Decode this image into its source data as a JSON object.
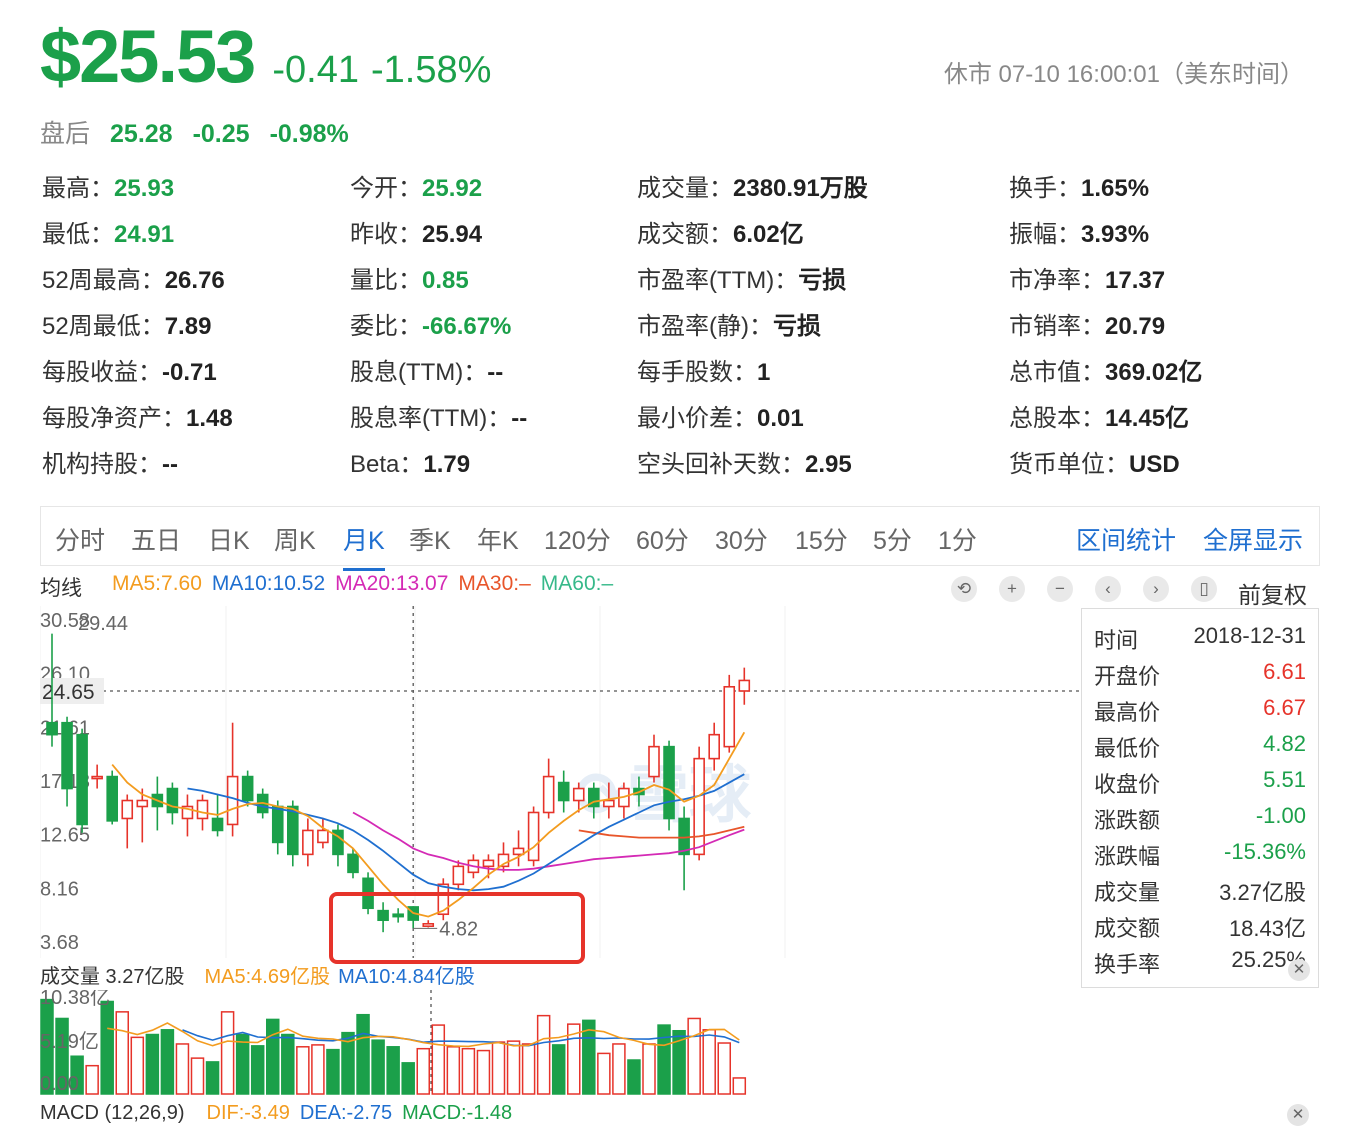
{
  "header": {
    "price": "$25.53",
    "change": "-0.41",
    "change_pct": "-1.58%",
    "status": "休市 07-10 16:00:01（美东时间）"
  },
  "after_hours": {
    "label": "盘后",
    "price": "25.28",
    "change": "-0.25",
    "change_pct": "-0.98%"
  },
  "stats": [
    [
      {
        "k": "最高：",
        "v": "25.93",
        "g": true
      },
      {
        "k": "今开：",
        "v": "25.92",
        "g": true
      },
      {
        "k": "成交量：",
        "v": "2380.91万股"
      },
      {
        "k": "换手：",
        "v": "1.65%"
      }
    ],
    [
      {
        "k": "最低：",
        "v": "24.91",
        "g": true
      },
      {
        "k": "昨收：",
        "v": "25.94"
      },
      {
        "k": "成交额：",
        "v": "6.02亿"
      },
      {
        "k": "振幅：",
        "v": "3.93%"
      }
    ],
    [
      {
        "k": "52周最高：",
        "v": "26.76"
      },
      {
        "k": "量比：",
        "v": "0.85",
        "g": true
      },
      {
        "k": "市盈率(TTM)：",
        "v": "亏损"
      },
      {
        "k": "市净率：",
        "v": "17.37"
      }
    ],
    [
      {
        "k": "52周最低：",
        "v": "7.89"
      },
      {
        "k": "委比：",
        "v": "-66.67%",
        "g": true
      },
      {
        "k": "市盈率(静)：",
        "v": "亏损"
      },
      {
        "k": "市销率：",
        "v": "20.79"
      }
    ],
    [
      {
        "k": "每股收益：",
        "v": "-0.71"
      },
      {
        "k": "股息(TTM)：",
        "v": "--"
      },
      {
        "k": "每手股数：",
        "v": "1"
      },
      {
        "k": "总市值：",
        "v": "369.02亿"
      }
    ],
    [
      {
        "k": "每股净资产：",
        "v": "1.48"
      },
      {
        "k": "股息率(TTM)：",
        "v": "--"
      },
      {
        "k": "最小价差：",
        "v": "0.01"
      },
      {
        "k": "总股本：",
        "v": "14.45亿"
      }
    ],
    [
      {
        "k": "机构持股：",
        "v": "--"
      },
      {
        "k": "Beta：",
        "v": "1.79"
      },
      {
        "k": "空头回补天数：",
        "v": "2.95"
      },
      {
        "k": "货币单位：",
        "v": "USD"
      }
    ]
  ],
  "tabs": [
    "分时",
    "五日",
    "日K",
    "周K",
    "月K",
    "季K",
    "年K",
    "120分",
    "60分",
    "30分",
    "15分",
    "5分",
    "1分"
  ],
  "active_tab": "月K",
  "tab_links": [
    "区间统计",
    "全屏显示"
  ],
  "ma_legend": {
    "label": "均线",
    "items": [
      {
        "text": "MA5:7.60",
        "color": "#f39c1f"
      },
      {
        "text": "MA10:10.52",
        "color": "#1f6fd0"
      },
      {
        "text": "MA20:13.07",
        "color": "#d42ab5"
      },
      {
        "text": "MA30:–",
        "color": "#e8552a"
      },
      {
        "text": "MA60:–",
        "color": "#37b98a"
      }
    ]
  },
  "controls": {
    "qfq": "前复权"
  },
  "chart_data": {
    "type": "candlestick",
    "y_ticks": [
      "30.58",
      "26.10",
      "21.61",
      "17.13",
      "12.65",
      "8.16",
      "3.68"
    ],
    "y_range": [
      3.68,
      30.58
    ],
    "crosshair_price": "24.65",
    "top_label": "29.44",
    "low_label": "4.82",
    "candles": [
      {
        "o": 22,
        "h": 29.44,
        "l": 20,
        "c": 21
      },
      {
        "o": 22,
        "h": 22.5,
        "l": 15,
        "c": 16.5
      },
      {
        "o": 21,
        "h": 21.5,
        "l": 12.8,
        "c": 13.5
      },
      {
        "o": 17.5,
        "h": 18.5,
        "l": 16.5,
        "c": 17.5
      },
      {
        "o": 17.5,
        "h": 18,
        "l": 13.5,
        "c": 13.8
      },
      {
        "o": 14,
        "h": 16,
        "l": 11.5,
        "c": 15.5
      },
      {
        "o": 15,
        "h": 16.5,
        "l": 12,
        "c": 15.5
      },
      {
        "o": 16,
        "h": 17.5,
        "l": 13,
        "c": 15
      },
      {
        "o": 16.5,
        "h": 17,
        "l": 13.5,
        "c": 14.5
      },
      {
        "o": 14,
        "h": 16,
        "l": 12.5,
        "c": 15
      },
      {
        "o": 14,
        "h": 16,
        "l": 13,
        "c": 15.5
      },
      {
        "o": 14,
        "h": 16,
        "l": 12.5,
        "c": 13
      },
      {
        "o": 13.5,
        "h": 22,
        "l": 12.5,
        "c": 17.5
      },
      {
        "o": 17.5,
        "h": 18,
        "l": 15,
        "c": 15.5
      },
      {
        "o": 16,
        "h": 16.5,
        "l": 14,
        "c": 14.5
      },
      {
        "o": 15,
        "h": 15.5,
        "l": 11,
        "c": 12
      },
      {
        "o": 15,
        "h": 15.5,
        "l": 10,
        "c": 11
      },
      {
        "o": 11,
        "h": 14,
        "l": 10,
        "c": 13
      },
      {
        "o": 12,
        "h": 14,
        "l": 11.5,
        "c": 13
      },
      {
        "o": 13,
        "h": 13.5,
        "l": 10,
        "c": 11
      },
      {
        "o": 11,
        "h": 11.5,
        "l": 9,
        "c": 9.5
      },
      {
        "o": 9,
        "h": 9.5,
        "l": 6,
        "c": 6.5
      },
      {
        "o": 6.3,
        "h": 7,
        "l": 4.5,
        "c": 5.5
      },
      {
        "o": 6,
        "h": 6.5,
        "l": 5.3,
        "c": 5.8
      },
      {
        "o": 6.61,
        "h": 6.67,
        "l": 4.82,
        "c": 5.51
      },
      {
        "o": 5,
        "h": 5.5,
        "l": 4.9,
        "c": 5.2
      },
      {
        "o": 6,
        "h": 9,
        "l": 5.5,
        "c": 8.5
      },
      {
        "o": 8.5,
        "h": 10.5,
        "l": 8,
        "c": 10
      },
      {
        "o": 9.5,
        "h": 11,
        "l": 9,
        "c": 10.5
      },
      {
        "o": 10,
        "h": 11,
        "l": 9,
        "c": 10.5
      },
      {
        "o": 10,
        "h": 12,
        "l": 9.5,
        "c": 11
      },
      {
        "o": 11,
        "h": 13,
        "l": 10,
        "c": 11.5
      },
      {
        "o": 10.5,
        "h": 15,
        "l": 10,
        "c": 14.5
      },
      {
        "o": 14.5,
        "h": 19,
        "l": 14,
        "c": 17.5
      },
      {
        "o": 17,
        "h": 18,
        "l": 14.5,
        "c": 15.5
      },
      {
        "o": 15.5,
        "h": 17,
        "l": 14.5,
        "c": 16.5
      },
      {
        "o": 16.5,
        "h": 17,
        "l": 14,
        "c": 15
      },
      {
        "o": 15,
        "h": 17,
        "l": 14,
        "c": 15.5
      },
      {
        "o": 15,
        "h": 17,
        "l": 14,
        "c": 16.5
      },
      {
        "o": 16.5,
        "h": 17.5,
        "l": 15,
        "c": 16
      },
      {
        "o": 17.5,
        "h": 21,
        "l": 17,
        "c": 20
      },
      {
        "o": 20,
        "h": 20.5,
        "l": 13,
        "c": 14
      },
      {
        "o": 14,
        "h": 15,
        "l": 8,
        "c": 11
      },
      {
        "o": 11,
        "h": 20,
        "l": 10.5,
        "c": 19
      },
      {
        "o": 19,
        "h": 22,
        "l": 18,
        "c": 21
      },
      {
        "o": 20,
        "h": 26,
        "l": 19.5,
        "c": 25
      },
      {
        "o": 24.65,
        "h": 26.6,
        "l": 23.5,
        "c": 25.53
      }
    ],
    "ma5": [
      null,
      null,
      null,
      null,
      18.5,
      17,
      16,
      15.5,
      15,
      14.8,
      14.5,
      14.3,
      14.8,
      15.2,
      15.3,
      15,
      14.8,
      14.2,
      13.2,
      12.5,
      11.5,
      10,
      8.5,
      7.2,
      6.1,
      5.8,
      6.3,
      7.2,
      8.2,
      9.3,
      10.2,
      10.8,
      11.6,
      12.8,
      13.8,
      14.7,
      15.4,
      15.6,
      15.8,
      16.2,
      16.8,
      16.4,
      15.4,
      15.9,
      16.8,
      19,
      21.2
    ],
    "ma10": [
      null,
      null,
      null,
      null,
      null,
      null,
      null,
      null,
      null,
      16.5,
      16.3,
      16,
      15.7,
      15.3,
      15,
      14.8,
      14.6,
      14.3,
      14,
      13.6,
      13,
      12.2,
      11.3,
      10.3,
      9.3,
      8.6,
      8.3,
      8.1,
      8,
      8.1,
      8.3,
      8.8,
      9.4,
      10.2,
      11,
      11.8,
      12.6,
      13.3,
      13.9,
      14.5,
      15.1,
      15.4,
      15.6,
      15.9,
      16.3,
      17,
      17.7
    ],
    "ma20": [
      null,
      null,
      null,
      null,
      null,
      null,
      null,
      null,
      null,
      null,
      null,
      null,
      null,
      null,
      null,
      null,
      null,
      null,
      null,
      null,
      14.5,
      13.8,
      13,
      12.3,
      11.5,
      11,
      10.7,
      10.3,
      10,
      9.8,
      9.7,
      9.7,
      9.8,
      10,
      10.2,
      10.4,
      10.6,
      10.7,
      10.8,
      10.9,
      11,
      11.1,
      11.3,
      11.6,
      12.1,
      12.6,
      13.07
    ],
    "ma30": [
      null,
      null,
      null,
      null,
      null,
      null,
      null,
      null,
      null,
      null,
      null,
      null,
      null,
      null,
      null,
      null,
      null,
      null,
      null,
      null,
      null,
      null,
      null,
      null,
      null,
      null,
      null,
      null,
      null,
      null,
      null,
      null,
      null,
      null,
      null,
      13,
      12.8,
      12.6,
      12.5,
      12.4,
      12.4,
      12.4,
      12.4,
      12.5,
      12.7,
      13,
      13.3
    ]
  },
  "tooltip": [
    {
      "k": "时间",
      "v": "2018-12-31",
      "c": "#333"
    },
    {
      "k": "开盘价",
      "v": "6.61",
      "c": "#e6332a"
    },
    {
      "k": "最高价",
      "v": "6.67",
      "c": "#e6332a"
    },
    {
      "k": "最低价",
      "v": "4.82",
      "c": "#1ba04a"
    },
    {
      "k": "收盘价",
      "v": "5.51",
      "c": "#1ba04a"
    },
    {
      "k": "涨跌额",
      "v": "-1.00",
      "c": "#1ba04a"
    },
    {
      "k": "涨跌幅",
      "v": "-15.36%",
      "c": "#1ba04a"
    },
    {
      "k": "成交量",
      "v": "3.27亿股",
      "c": "#333"
    },
    {
      "k": "成交额",
      "v": "18.43亿",
      "c": "#333"
    },
    {
      "k": "换手率",
      "v": "25.25%",
      "c": "#333"
    }
  ],
  "volume_legend": {
    "label": "成交量 3.27亿股",
    "ma5": "MA5:4.69亿股",
    "ma10": "MA10:4.84亿股",
    "ma5_color": "#f39c1f",
    "ma10_color": "#1f6fd0"
  },
  "volume_data": {
    "y_ticks": [
      "10.38亿",
      "5.19亿",
      "0.00"
    ],
    "values": [
      10,
      8,
      4,
      3,
      9.8,
      8.7,
      6,
      6.3,
      6.8,
      5.3,
      3.8,
      3.4,
      8.7,
      6.3,
      5.1,
      7.9,
      6.3,
      5,
      5.2,
      4.7,
      6.5,
      8.4,
      5.7,
      5,
      3.3,
      4.8,
      7.3,
      5,
      4.8,
      4.6,
      5.5,
      5.6,
      5.3,
      8.3,
      5.2,
      7.4,
      7.8,
      4.3,
      5.3,
      3.6,
      5.3,
      7.3,
      6.7,
      8,
      6.8,
      5.4,
      1.7
    ]
  },
  "macd": {
    "label": "MACD (12,26,9)",
    "dif": "DIF:-3.49",
    "dea": "DEA:-2.75",
    "macd": "MACD:-1.48",
    "dif_color": "#f39c1f",
    "dea_color": "#1f6fd0",
    "macd_color": "#1ba04a"
  }
}
